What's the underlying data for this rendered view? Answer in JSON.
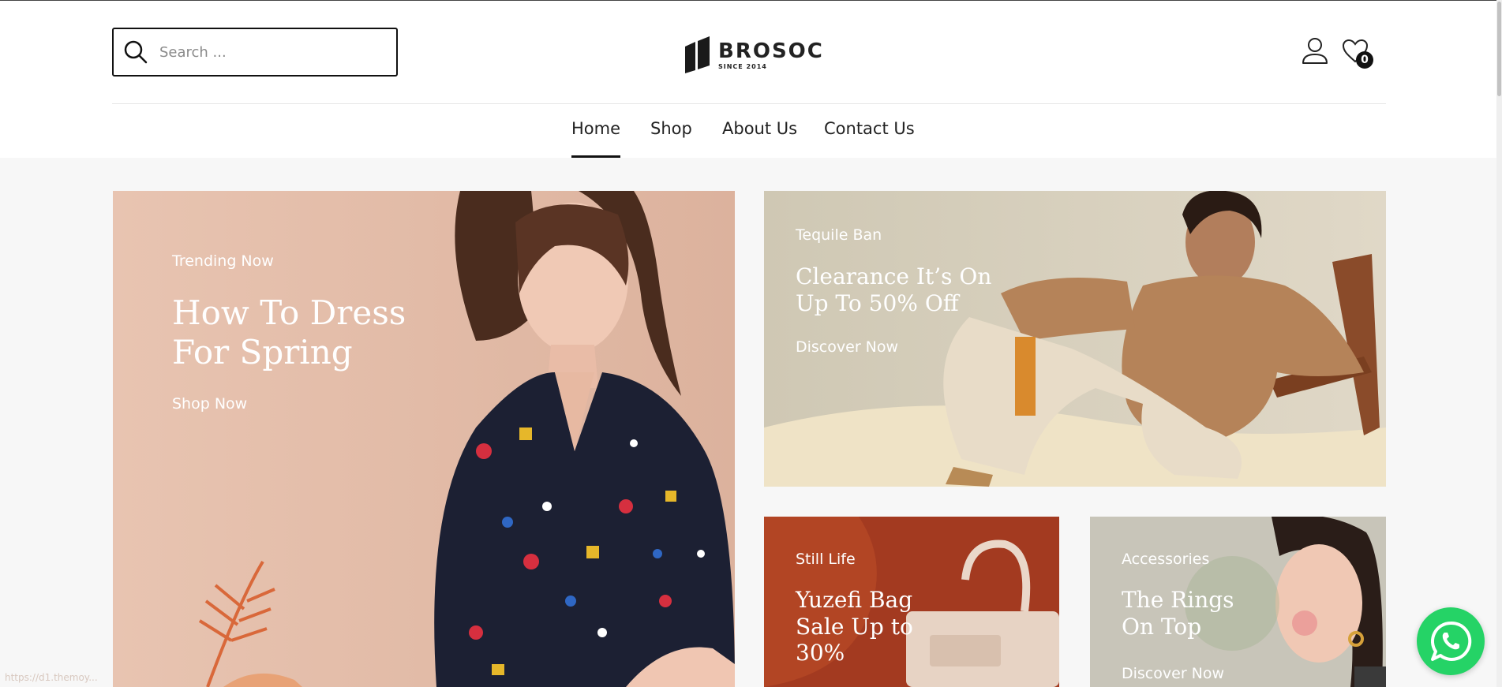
{
  "search": {
    "placeholder": "Search ..."
  },
  "logo": {
    "brand": "BROSOC",
    "tagline": "SINCE 2014"
  },
  "header": {
    "wishlist_count": "0"
  },
  "nav": {
    "items": [
      {
        "label": "Home",
        "active": true
      },
      {
        "label": "Shop"
      },
      {
        "label": "About Us"
      },
      {
        "label": "Contact Us"
      }
    ]
  },
  "banners": [
    {
      "eyebrow": "Trending Now",
      "title_lines": [
        "How To Dress",
        "For Spring"
      ],
      "cta": "Shop Now"
    },
    {
      "eyebrow": "Tequile Ban",
      "title_lines": [
        "Clearance It’s On",
        "Up To 50% Off"
      ],
      "cta": "Discover Now"
    },
    {
      "eyebrow": "Still Life",
      "title_lines": [
        "Yuzefi Bag",
        "Sale Up to",
        "30%"
      ]
    },
    {
      "eyebrow": "Accessories",
      "title_lines": [
        "The Rings",
        "On Top"
      ],
      "cta": "Discover Now"
    }
  ],
  "status_bar": {
    "url": "https://d1.themoy..."
  },
  "icons": {
    "search": "search-icon",
    "logo": "logo-mark-icon",
    "user": "user-icon",
    "wishlist": "heart-icon",
    "whatsapp": "whatsapp-icon"
  },
  "colors": {
    "header_bg": "#ffffff",
    "page_bg": "#f7f7f7",
    "text": "#222222",
    "whatsapp": "#25d366",
    "banner1_bg": "#e5c0ad",
    "banner3_bg": "#a73a1f"
  }
}
